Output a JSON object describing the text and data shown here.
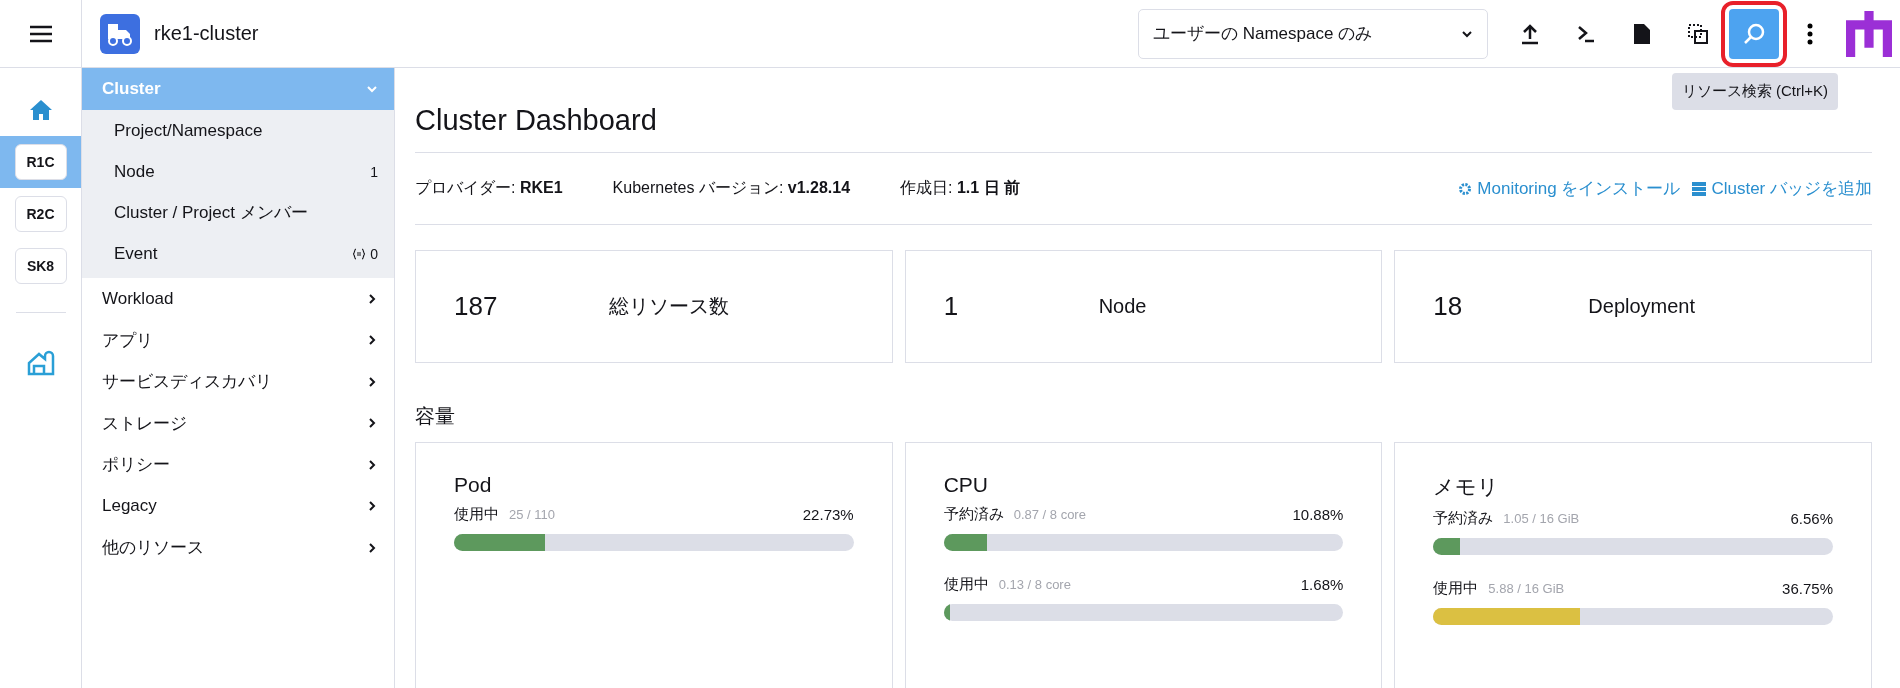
{
  "header": {
    "cluster_name": "rke1-cluster",
    "namespace_filter": "ユーザーの Namespace のみ",
    "tooltip": "リソース検索 (Ctrl+K)",
    "toolbar": [
      {
        "kind": "upload",
        "highlighted": false
      },
      {
        "kind": "shell",
        "highlighted": false
      },
      {
        "kind": "file",
        "highlighted": false
      },
      {
        "kind": "copy",
        "highlighted": false
      },
      {
        "kind": "search",
        "highlighted": true
      },
      {
        "kind": "more",
        "highlighted": false
      }
    ]
  },
  "rail": {
    "items": [
      {
        "kind": "home"
      },
      {
        "kind": "badge",
        "label": "R1C",
        "selected": true
      },
      {
        "kind": "badge",
        "label": "R2C",
        "selected": false
      },
      {
        "kind": "badge",
        "label": "SK8",
        "selected": false
      },
      {
        "kind": "divider"
      },
      {
        "kind": "cluster"
      }
    ]
  },
  "sidebar": {
    "group": {
      "label": "Cluster",
      "expanded": true,
      "children": [
        {
          "label": "Project/Namespace"
        },
        {
          "label": "Node",
          "count": "1"
        },
        {
          "label": "Cluster / Project メンバー"
        },
        {
          "label": "Event",
          "count": "0",
          "icon": true
        }
      ]
    },
    "items": [
      {
        "label": "Workload"
      },
      {
        "label": "アプリ"
      },
      {
        "label": "サービスディスカバリ"
      },
      {
        "label": "ストレージ"
      },
      {
        "label": "ポリシー"
      },
      {
        "label": "Legacy"
      },
      {
        "label": "他のリソース"
      }
    ]
  },
  "page": {
    "title": "Cluster Dashboard",
    "info": [
      {
        "label": "プロバイダー:",
        "value": "RKE1"
      },
      {
        "label": "Kubernetes バージョン:",
        "value": "v1.28.14"
      },
      {
        "label": "作成日:",
        "value": "1.1 日 前"
      }
    ],
    "actions": [
      {
        "kind": "gear",
        "label": "Monitoring をインストール"
      },
      {
        "kind": "badge",
        "label": "Cluster バッジを追加"
      }
    ],
    "stats": [
      {
        "count": "187",
        "label": "総リソース数"
      },
      {
        "count": "1",
        "label": "Node"
      },
      {
        "count": "18",
        "label": "Deployment"
      }
    ],
    "capacity_title": "容量",
    "capacity": [
      {
        "title": "Pod",
        "meters": [
          {
            "label": "使用中",
            "detail": "25 / 110",
            "percent": "22.73%",
            "level": 0.2273,
            "color": "#5d995d"
          }
        ]
      },
      {
        "title": "CPU",
        "meters": [
          {
            "label": "予約済み",
            "detail": "0.87 / 8 core",
            "percent": "10.88%",
            "level": 0.1088,
            "color": "#5d995d"
          },
          {
            "label": "使用中",
            "detail": "0.13 / 8 core",
            "percent": "1.68%",
            "level": 0.0168,
            "color": "#5d995d"
          }
        ]
      },
      {
        "title": "メモリ",
        "meters": [
          {
            "label": "予約済み",
            "detail": "1.05 / 16 GiB",
            "percent": "6.56%",
            "level": 0.0656,
            "color": "#5d995d"
          },
          {
            "label": "使用中",
            "detail": "5.88 / 16 GiB",
            "percent": "36.75%",
            "level": 0.3675,
            "color": "#dbc042"
          }
        ]
      }
    ]
  }
}
